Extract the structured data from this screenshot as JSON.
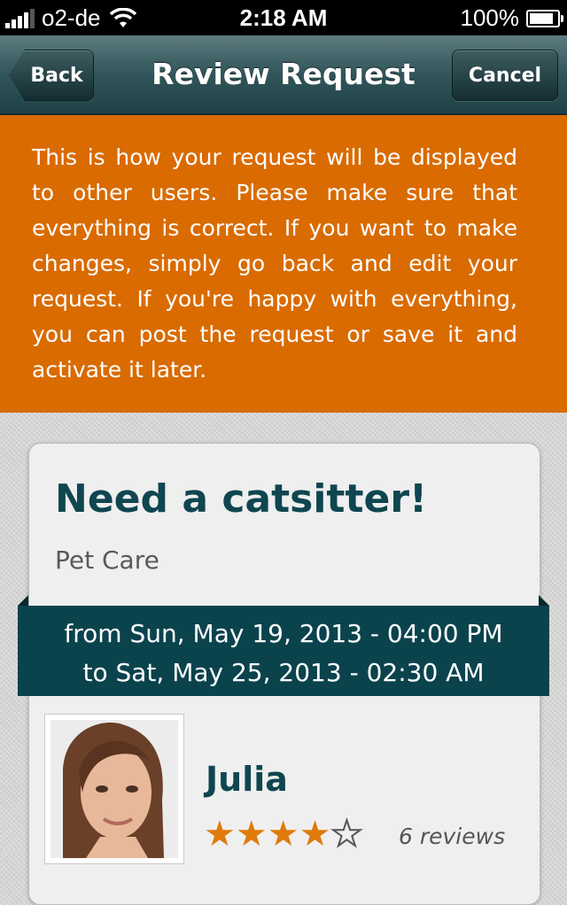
{
  "status_bar": {
    "carrier": "o2-de",
    "time": "2:18 AM",
    "battery": "100%",
    "battery_level": 1.0
  },
  "nav": {
    "title": "Review Request",
    "back_label": "Back",
    "cancel_label": "Cancel"
  },
  "info_text": "This is how your request will be displayed to other users. Please make sure that everything is correct. If you want to make changes, simply go back and edit your request. If you're happy with everything, you can post the request or save it and activate it later.",
  "request": {
    "title": "Need a catsitter!",
    "category": "Pet Care",
    "from": "from Sun, May 19, 2013 - 04:00 PM",
    "to": "to Sat, May 25, 2013 - 02:30 AM"
  },
  "user": {
    "name": "Julia",
    "rating": 4,
    "rating_max": 5,
    "reviews": "6 reviews"
  },
  "colors": {
    "accent_orange": "#d96b00",
    "brand_teal": "#0b434d"
  }
}
